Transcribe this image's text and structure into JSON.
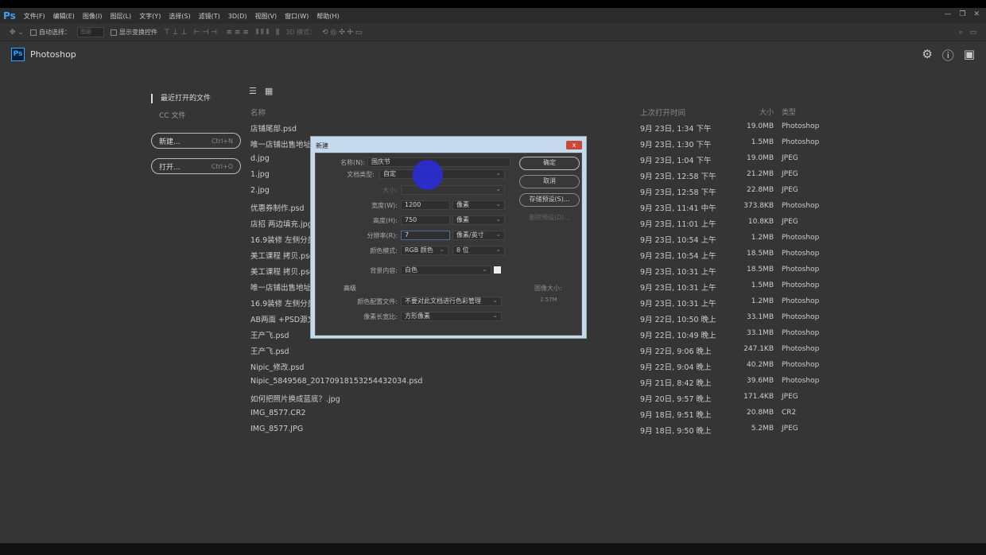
{
  "menubar": {
    "logo": "Ps",
    "items": [
      "文件(F)",
      "编辑(E)",
      "图像(I)",
      "图层(L)",
      "文字(Y)",
      "选择(S)",
      "滤镜(T)",
      "3D(D)",
      "视图(V)",
      "窗口(W)",
      "帮助(H)"
    ]
  },
  "optbar": {
    "auto_select": "自动选择：",
    "auto_select_value": "图层",
    "show_transform": "显示变换控件",
    "mode_3d": "3D 模式："
  },
  "header": {
    "logo": "Ps",
    "title": "Photoshop"
  },
  "sidebar": {
    "recent": "最近打开的文件",
    "cc": "CC 文件",
    "new_label": "新建...",
    "new_key": "Ctrl+N",
    "open_label": "打开...",
    "open_key": "Ctrl+O"
  },
  "list": {
    "headers": {
      "name": "名称",
      "date": "上次打开时间",
      "size": "大小",
      "type": "类型"
    },
    "rows": [
      {
        "name": "店铺尾部.psd",
        "date": "9月 23日, 1:34 下午",
        "size": "19.0MB",
        "type": "Photoshop"
      },
      {
        "name": "唯一店铺出售地址 拷贝.psd",
        "date": "9月 23日, 1:30 下午",
        "size": "1.5MB",
        "type": "Photoshop"
      },
      {
        "name": "d.jpg",
        "date": "9月 23日, 1:04 下午",
        "size": "19.0MB",
        "type": "JPEG"
      },
      {
        "name": "1.jpg",
        "date": "9月 23日, 12:58 下午",
        "size": "21.2MB",
        "type": "JPEG"
      },
      {
        "name": "2.jpg",
        "date": "9月 23日, 12:58 下午",
        "size": "22.8MB",
        "type": "JPEG"
      },
      {
        "name": "优惠券制作.psd",
        "date": "9月 23日, 11:41 中午",
        "size": "373.8KB",
        "type": "Photoshop"
      },
      {
        "name": "店招 两边填充.jpg",
        "date": "9月 23日, 11:01 上午",
        "size": "10.8KB",
        "type": "JPEG"
      },
      {
        "name": "16.9装修 左侧分类",
        "date": "9月 23日, 10:54 上午",
        "size": "1.2MB",
        "type": "Photoshop"
      },
      {
        "name": "美工课程 拷贝.psd",
        "date": "9月 23日, 10:54 上午",
        "size": "18.5MB",
        "type": "Photoshop"
      },
      {
        "name": "美工课程 拷贝.psd",
        "date": "9月 23日, 10:31 上午",
        "size": "18.5MB",
        "type": "Photoshop"
      },
      {
        "name": "唯一店铺出售地址",
        "date": "9月 23日, 10:31 上午",
        "size": "1.5MB",
        "type": "Photoshop"
      },
      {
        "name": "16.9装修 左侧分类",
        "date": "9月 23日, 10:31 上午",
        "size": "1.2MB",
        "type": "Photoshop"
      },
      {
        "name": "AB两面 +PSD源文件",
        "date": "9月 22日, 10:50 晚上",
        "size": "33.1MB",
        "type": "Photoshop"
      },
      {
        "name": "王产飞.psd",
        "date": "9月 22日, 10:49 晚上",
        "size": "33.1MB",
        "type": "Photoshop"
      },
      {
        "name": "王产飞.psd",
        "date": "9月 22日, 9:06 晚上",
        "size": "247.1KB",
        "type": "Photoshop"
      },
      {
        "name": "Nipic_修改.psd",
        "date": "9月 22日, 9:04 晚上",
        "size": "40.2MB",
        "type": "Photoshop"
      },
      {
        "name": "Nipic_5849568_20170918153254432034.psd",
        "date": "9月 21日, 8:42 晚上",
        "size": "39.6MB",
        "type": "Photoshop"
      },
      {
        "name": "如何把照片换成蓝底？.jpg",
        "date": "9月 20日, 9:57 晚上",
        "size": "171.4KB",
        "type": "JPEG"
      },
      {
        "name": "IMG_8577.CR2",
        "date": "9月 18日, 9:51 晚上",
        "size": "20.8MB",
        "type": "CR2"
      },
      {
        "name": "IMG_8577.JPG",
        "date": "9月 18日, 9:50 晚上",
        "size": "5.2MB",
        "type": "JPEG"
      }
    ]
  },
  "dialog": {
    "title": "新建",
    "close": "x",
    "name_label": "名称(N):",
    "name_value": "国庆节",
    "preset_label": "文档类型:",
    "preset_value": "自定",
    "size_label": "大小:",
    "width_label": "宽度(W):",
    "width_value": "1200",
    "width_unit": "像素",
    "height_label": "高度(H):",
    "height_value": "750",
    "height_unit": "像素",
    "res_label": "分辨率(R):",
    "res_value": "7",
    "res_unit": "像素/英寸",
    "mode_label": "颜色模式:",
    "mode_value": "RGB 颜色",
    "depth_value": "8 位",
    "bg_label": "背景内容:",
    "bg_value": "白色",
    "advanced": "高级",
    "profile_label": "颜色配置文件:",
    "profile_value": "不要对此文档进行色彩管理",
    "aspect_label": "像素长宽比:",
    "aspect_value": "方形像素",
    "ok": "确定",
    "cancel": "取消",
    "save_preset": "存储预设(S)...",
    "delete_preset": "删除预设(D)...",
    "image_size_label": "图像大小:",
    "image_size_value": "2.57M"
  }
}
